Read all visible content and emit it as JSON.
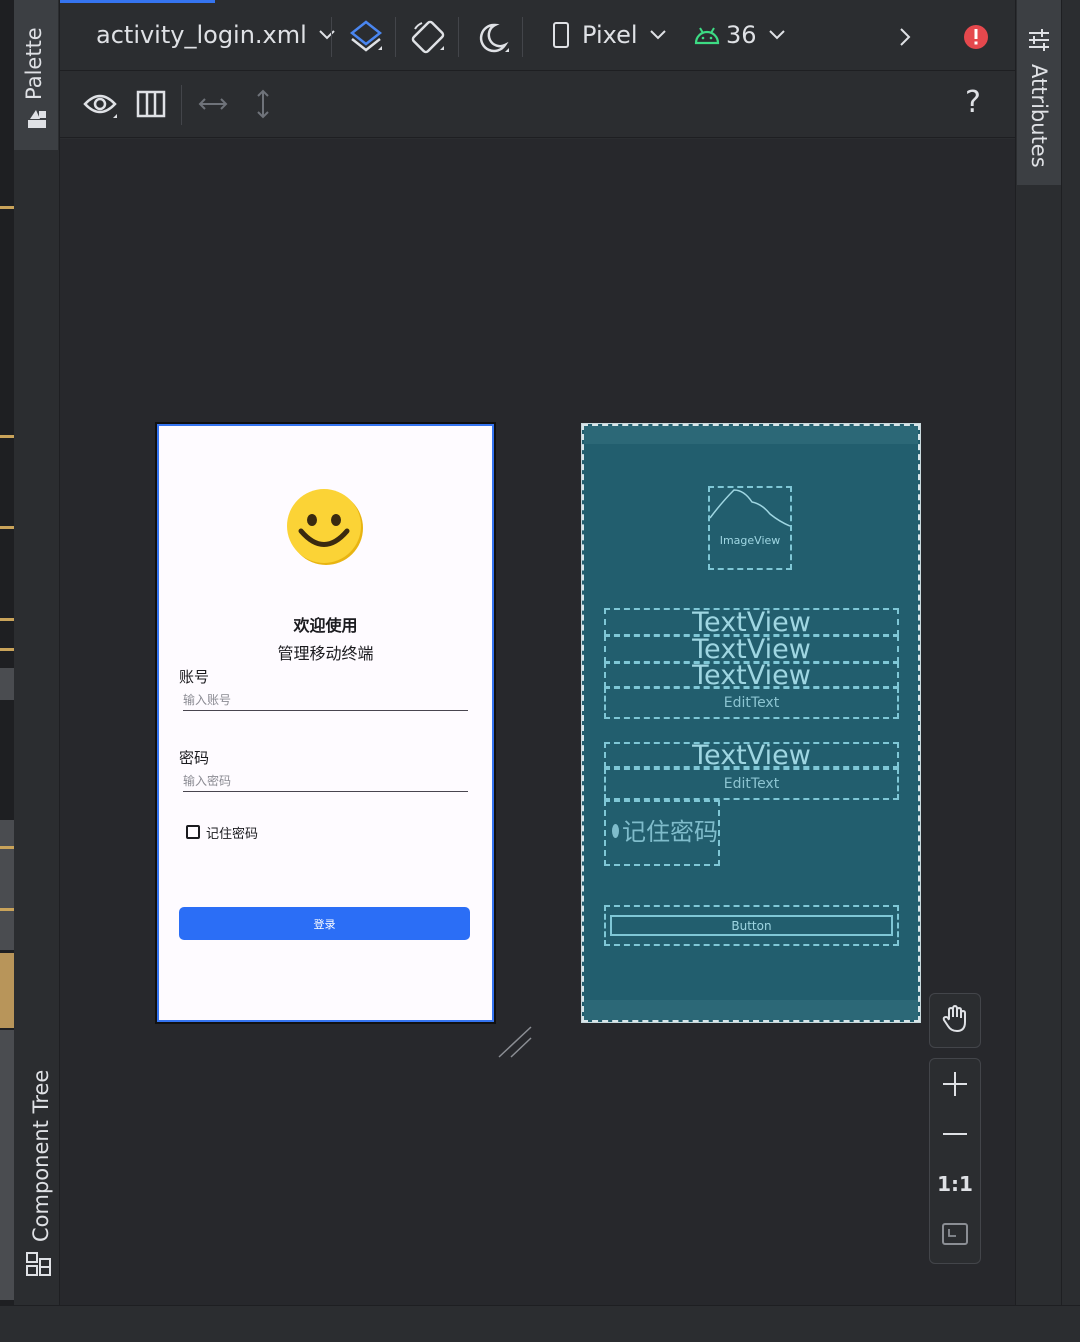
{
  "toolbar": {
    "file_name": "activity_login.xml",
    "device": "Pixel",
    "api_level": "36",
    "help": "?"
  },
  "sidebars": {
    "palette": "Palette",
    "component_tree": "Component Tree",
    "attributes": "Attributes"
  },
  "design": {
    "welcome": "欢迎使用",
    "subtitle": "管理移动终端",
    "account_label": "账号",
    "account_hint": "输入账号",
    "password_label": "密码",
    "password_hint": "输入密码",
    "remember": "记住密码",
    "login_button": "登录"
  },
  "blueprint": {
    "image_view": "ImageView",
    "text_view": "TextView",
    "edit_text": "EditText",
    "checkbox_text": "记住密码",
    "button": "Button"
  },
  "zoom": {
    "actual_size": "1:1"
  },
  "colors": {
    "accent": "#3574f0",
    "error": "#e5484d",
    "android": "#3ddc84",
    "blueprint_bg": "#225e6e",
    "login_button": "#2b6ef6"
  }
}
